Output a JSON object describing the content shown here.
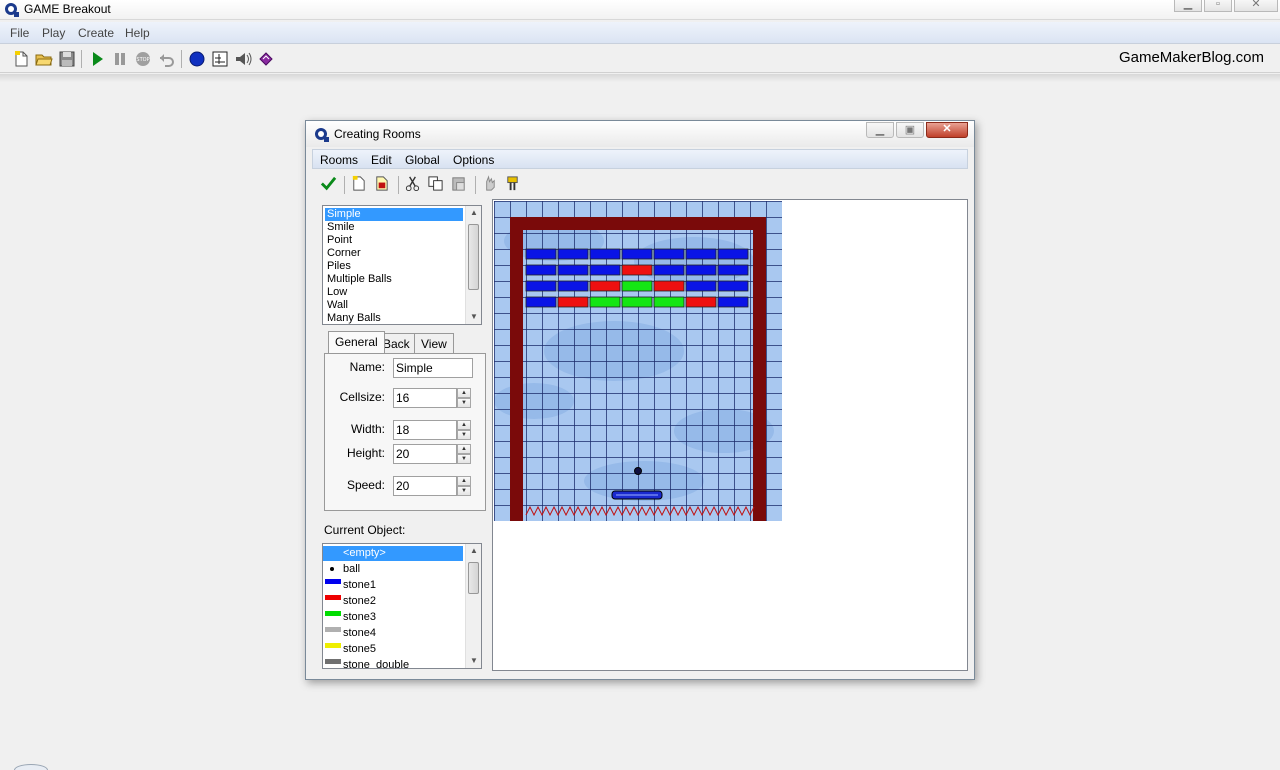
{
  "app": {
    "title": "GAME Breakout",
    "brand": "GameMakerBlog.com",
    "menu": [
      "File",
      "Play",
      "Create",
      "Help"
    ],
    "toolbar_icons": [
      "new-file-icon",
      "open-folder-icon",
      "save-icon",
      "play-icon",
      "pause-icon",
      "stop-icon",
      "undo-icon",
      "sprite-icon",
      "background-icon",
      "sound-icon",
      "script-icon"
    ]
  },
  "dialog": {
    "title": "Creating Rooms",
    "menu": [
      "Rooms",
      "Edit",
      "Global",
      "Options"
    ],
    "toolbar_icons": [
      "check-icon",
      "new-room-icon",
      "add-room-icon",
      "cut-icon",
      "copy-icon",
      "paste-icon",
      "hand-icon",
      "test-icon"
    ],
    "rooms": {
      "items": [
        "Simple",
        "Smile",
        "Point",
        "Corner",
        "Piles",
        "Multiple Balls",
        "Low",
        "Wall",
        "Many Balls"
      ],
      "selected": "Simple"
    },
    "tabs": [
      "General",
      "Back",
      "View"
    ],
    "active_tab": "General",
    "general": {
      "name_label": "Name:",
      "name_value": "Simple",
      "cellsize_label": "Cellsize:",
      "cellsize_value": "16",
      "width_label": "Width:",
      "width_value": "18",
      "height_label": "Height:",
      "height_value": "20",
      "speed_label": "Speed:",
      "speed_value": "20"
    },
    "current_object_label": "Current Object:",
    "objects": [
      {
        "name": "<empty>",
        "selected": true,
        "swatch": ""
      },
      {
        "name": "ball",
        "selected": false,
        "swatch": "dot"
      },
      {
        "name": "stone1",
        "selected": false,
        "swatch": "#0000ee"
      },
      {
        "name": "stone2",
        "selected": false,
        "swatch": "#ee0000"
      },
      {
        "name": "stone3",
        "selected": false,
        "swatch": "#00dd00"
      },
      {
        "name": "stone4",
        "selected": false,
        "swatch": "#b0b0b0"
      },
      {
        "name": "stone5",
        "selected": false,
        "swatch": "#eeee00"
      },
      {
        "name": "stone_double",
        "selected": false,
        "swatch": "#707070"
      }
    ]
  },
  "room": {
    "cols": 18,
    "rows": 20,
    "bricks": [
      [
        "stone1",
        "stone1",
        "stone1",
        "stone1",
        "stone1",
        "stone1",
        "stone1"
      ],
      [
        "stone1",
        "stone1",
        "stone1",
        "stone2",
        "stone1",
        "stone1",
        "stone1"
      ],
      [
        "stone1",
        "stone1",
        "stone2",
        "stone3",
        "stone2",
        "stone1",
        "stone1"
      ],
      [
        "stone1",
        "stone2",
        "stone3",
        "stone3",
        "stone3",
        "stone2",
        "stone1"
      ]
    ],
    "colors": {
      "stone1": "#0a14e6",
      "stone2": "#ee1010",
      "stone3": "#14e614",
      "wall": "#7a0a0a",
      "sky": "#a9c8f0",
      "grid": "#1a2a6a"
    }
  }
}
